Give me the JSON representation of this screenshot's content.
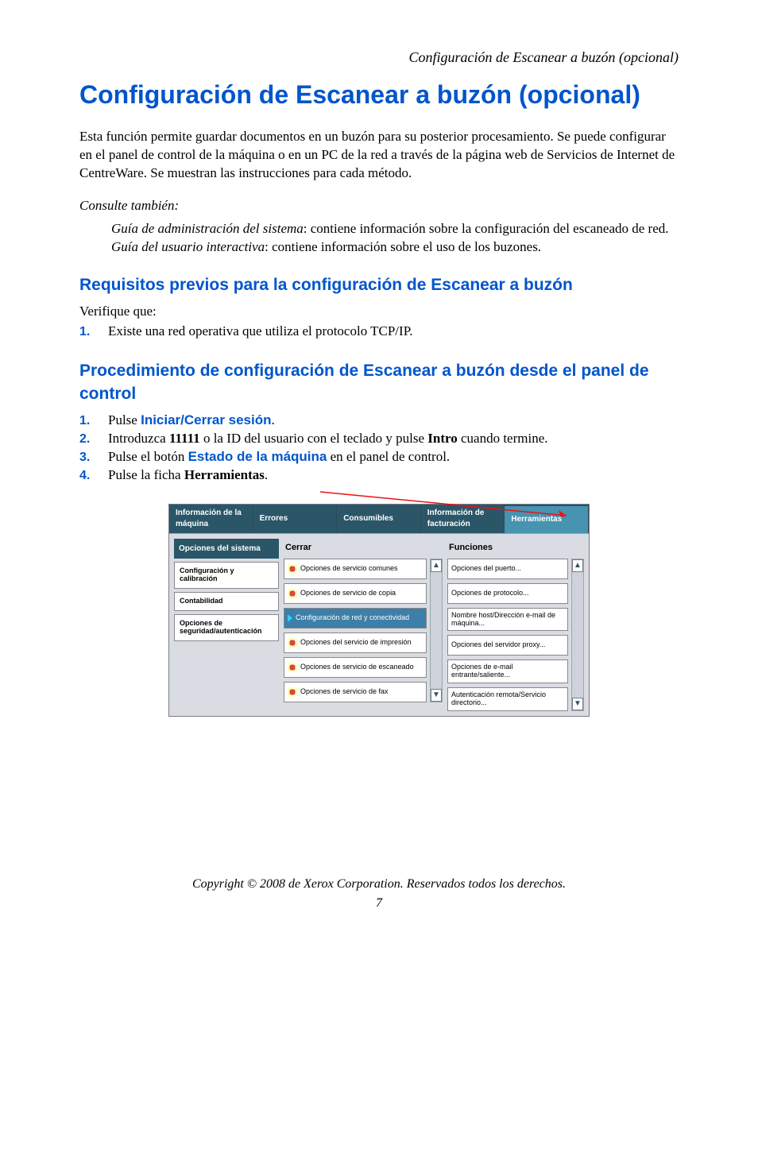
{
  "header": {
    "running": "Configuración de Escanear a buzón (opcional)"
  },
  "title": "Configuración de Escanear a buzón (opcional)",
  "intro": "Esta función permite guardar documentos en un buzón para su posterior procesamiento. Se puede configurar en el panel de control de la máquina o en un PC de la red a través de la página web de Servicios de Internet de CentreWare. Se muestran las instrucciones para cada método.",
  "consulte": "Consulte también:",
  "refs": {
    "r1a": "Guía de administración del sistema",
    "r1b": ": contiene información sobre la configuración del escaneado de red.",
    "r2a": "Guía del usuario interactiva",
    "r2b": ": contiene información sobre el uso de los buzones."
  },
  "section1": {
    "title": "Requisitos previos para la configuración de Escanear a buzón",
    "verifique": "Verifique que:",
    "items": [
      {
        "n": "1.",
        "text": "Existe una red operativa que utiliza el protocolo TCP/IP."
      }
    ]
  },
  "section2": {
    "title": "Procedimiento de configuración de Escanear a buzón desde el panel de control",
    "items": [
      {
        "n": "1.",
        "pre": "Pulse ",
        "kw": "Iniciar/Cerrar sesión",
        "post": "."
      },
      {
        "n": "2.",
        "pre": "Introduzca ",
        "kb": "11111",
        "mid": " o la ID del usuario con el teclado y pulse ",
        "kb2": "Intro",
        "post": " cuando termine."
      },
      {
        "n": "3.",
        "pre": "Pulse el botón ",
        "kw": "Estado de la máquina",
        "post": " en el panel de control."
      },
      {
        "n": "4.",
        "pre": "Pulse la ficha ",
        "kb": "Herramientas",
        "post": "."
      }
    ]
  },
  "panel": {
    "tabs": [
      "Información de la máquina",
      "Errores",
      "Consumibles",
      "Información de facturación",
      "Herramientas"
    ],
    "side_header": "Opciones del sistema",
    "side": [
      "Configuración y calibración",
      "Contabilidad",
      "Opciones de seguridad/autenticación"
    ],
    "left_hdr": "Cerrar",
    "right_hdr": "Funciones",
    "left": [
      "Opciones de servicio comunes",
      "Opciones de servicio de copia",
      "Configuración de red y conectividad",
      "Opciones del servicio de impresión",
      "Opciones de servicio de escaneado",
      "Opciones de servicio de fax"
    ],
    "right": [
      "Opciones del puerto...",
      "Opciones de protocolo...",
      "Nombre host/Dirección e-mail de máquina...",
      "Opciones del servidor proxy...",
      "Opciones de e-mail entrante/saliente...",
      "Autenticación remota/Servicio directorio..."
    ]
  },
  "footer": {
    "copyright": "Copyright © 2008 de Xerox Corporation. Reservados todos los derechos.",
    "page": "7"
  }
}
